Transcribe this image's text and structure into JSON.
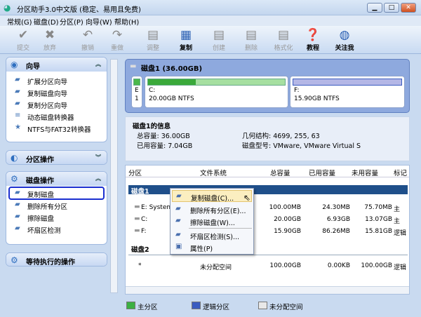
{
  "window": {
    "title": "分区助手3.0中文版 (稳定、易用且免费)"
  },
  "menu": [
    "常规(G)",
    "磁盘(D)",
    "分区(P)",
    "向导(W)",
    "帮助(H)"
  ],
  "toolbar": [
    {
      "label": "提交",
      "icon": "check-icon",
      "enabled": false
    },
    {
      "label": "放弃",
      "icon": "x-icon",
      "enabled": false
    },
    {
      "label": "撤销",
      "icon": "undo-icon",
      "enabled": false
    },
    {
      "label": "重做",
      "icon": "redo-icon",
      "enabled": false
    },
    {
      "label": "调整",
      "icon": "resize-disk-icon",
      "enabled": false
    },
    {
      "label": "复制",
      "icon": "copy-disk-icon",
      "enabled": true
    },
    {
      "label": "创建",
      "icon": "create-disk-icon",
      "enabled": false
    },
    {
      "label": "删除",
      "icon": "delete-disk-icon",
      "enabled": false
    },
    {
      "label": "格式化",
      "icon": "format-disk-icon",
      "enabled": false
    },
    {
      "label": "教程",
      "icon": "help-icon",
      "enabled": true
    },
    {
      "label": "关注我",
      "icon": "globe-icon",
      "enabled": true
    }
  ],
  "sidebar": {
    "wizard": {
      "title": "向导",
      "items": [
        "扩展分区向导",
        "复制磁盘向导",
        "复制分区向导",
        "动态磁盘转换器",
        "NTFS与FAT32转换器"
      ]
    },
    "partition_ops": {
      "title": "分区操作"
    },
    "disk_ops": {
      "title": "磁盘操作",
      "items": [
        "复制磁盘",
        "删除所有分区",
        "擦除磁盘",
        "坏扇区检测"
      ]
    },
    "pending": {
      "title": "等待执行的操作"
    }
  },
  "diskmap": {
    "title": "磁盘1 (36.00GB)",
    "parts": [
      {
        "label": "E",
        "sub": "1"
      },
      {
        "label": "C:",
        "sub": "20.00GB NTFS",
        "used_pct": 35
      },
      {
        "label": "F:",
        "sub": "15.90GB NTFS"
      }
    ]
  },
  "info": {
    "title": "磁盘1的信息",
    "total": "总容量: 36.00GB",
    "used": "已用容量: 7.04GB",
    "geometry": "几何结构: 4699, 255, 63",
    "model": "磁盘型号: VMware, VMware Virtual S"
  },
  "table": {
    "headers": [
      "分区",
      "文件系统",
      "总容量",
      "已用容量",
      "未用容量",
      "标记"
    ],
    "disk1": "磁盘1",
    "disk2": "磁盘2",
    "rows": [
      [
        "E:  System",
        "",
        "100.00MB",
        "24.30MB",
        "75.70MB",
        "主"
      ],
      [
        "C:",
        "",
        "20.00GB",
        "6.93GB",
        "13.07GB",
        "主"
      ],
      [
        "F:",
        "",
        "15.90GB",
        "86.26MB",
        "15.81GB",
        "逻辑"
      ]
    ],
    "rows2": [
      [
        "*",
        "未分配空间",
        "100.00GB",
        "0.00KB",
        "100.00GB",
        "逻辑"
      ]
    ]
  },
  "context_menu": [
    "复制磁盘(C)...",
    "删除所有分区(E)...",
    "擦除磁盘(W)...",
    "坏扇区检测(S)...",
    "属性(P)"
  ],
  "legend": [
    {
      "label": "主分区",
      "color": "#3cb043"
    },
    {
      "label": "逻辑分区",
      "color": "#3a5cc0"
    },
    {
      "label": "未分配空间",
      "color": "#e8e8e8"
    }
  ]
}
